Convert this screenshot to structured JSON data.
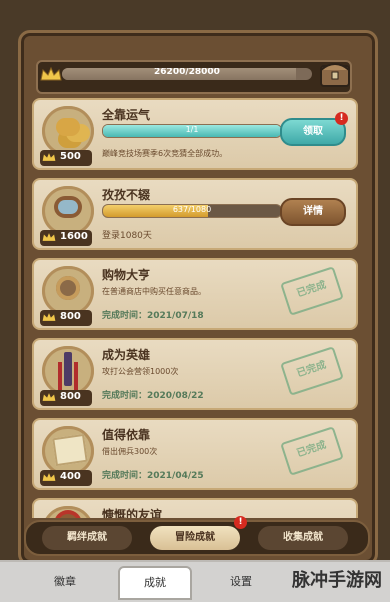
{
  "header": {
    "progress_text": "26200/28000",
    "progress_fraction": 0.9357
  },
  "achievements": [
    {
      "title": "全靠运气",
      "desc": "巅峰竞技场赛季6次竞猜全部成功。",
      "level": "500",
      "progress_text": "1/1",
      "progress_fraction": 1.0,
      "button": "领取",
      "badge": "!"
    },
    {
      "title": "孜孜不辍",
      "desc": "登录1080天",
      "level": "1600",
      "progress_text": "637/1080",
      "progress_fraction": 0.59,
      "button": "详情"
    },
    {
      "title": "购物大亨",
      "desc": "在普通商店中购买任意商品。",
      "level": "800",
      "date": "完成时间：2021/07/18",
      "stamp": "已完成"
    },
    {
      "title": "成为英雄",
      "desc": "攻打公会营领1000次",
      "level": "800",
      "date": "完成时间：2020/08/22",
      "stamp": "已完成"
    },
    {
      "title": "值得依靠",
      "desc": "借出佣兵300次",
      "level": "400",
      "date": "完成时间：2021/04/25",
      "stamp": "已完成"
    },
    {
      "title": "慷慨的友谊"
    }
  ],
  "tabs": [
    {
      "label": "羁绊成就"
    },
    {
      "label": "冒险成就",
      "badge": "!"
    },
    {
      "label": "收集成就"
    }
  ],
  "bottom_nav": [
    {
      "label": "徽章"
    },
    {
      "label": "成就"
    },
    {
      "label": "设置"
    }
  ],
  "watermark": "脉冲手游网",
  "colors": {
    "accent_teal": "#3fa9a8",
    "bar_gold": "#e7b442",
    "complete_green": "#7fae86",
    "badge_red": "#d62a1f"
  }
}
